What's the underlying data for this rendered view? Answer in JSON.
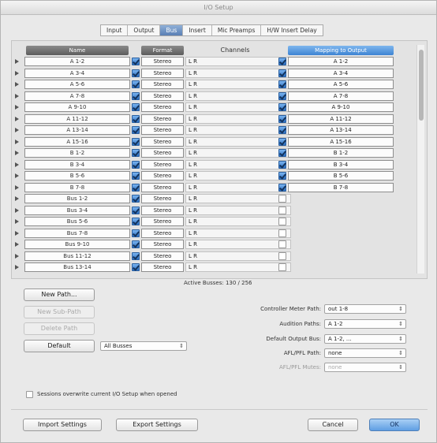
{
  "window": {
    "title": "I/O Setup"
  },
  "tabs": [
    "Input",
    "Output",
    "Bus",
    "Insert",
    "Mic Preamps",
    "H/W Insert Delay"
  ],
  "active_tab": "Bus",
  "columns": {
    "name": "Name",
    "format": "Format",
    "channels": "Channels",
    "mapping": "Mapping to Output"
  },
  "rows": [
    {
      "name": "A 1-2",
      "format": "Stereo",
      "channels": "L  R",
      "mapped": true,
      "output": "A 1-2"
    },
    {
      "name": "A 3-4",
      "format": "Stereo",
      "channels": "L  R",
      "mapped": true,
      "output": "A 3-4"
    },
    {
      "name": "A 5-6",
      "format": "Stereo",
      "channels": "L  R",
      "mapped": true,
      "output": "A 5-6"
    },
    {
      "name": "A 7-8",
      "format": "Stereo",
      "channels": "L  R",
      "mapped": true,
      "output": "A 7-8"
    },
    {
      "name": "A 9-10",
      "format": "Stereo",
      "channels": "L  R",
      "mapped": true,
      "output": "A 9-10"
    },
    {
      "name": "A 11-12",
      "format": "Stereo",
      "channels": "L  R",
      "mapped": true,
      "output": "A 11-12"
    },
    {
      "name": "A 13-14",
      "format": "Stereo",
      "channels": "L  R",
      "mapped": true,
      "output": "A 13-14"
    },
    {
      "name": "A 15-16",
      "format": "Stereo",
      "channels": "L  R",
      "mapped": true,
      "output": "A 15-16"
    },
    {
      "name": "B 1-2",
      "format": "Stereo",
      "channels": "L  R",
      "mapped": true,
      "output": "B 1-2"
    },
    {
      "name": "B 3-4",
      "format": "Stereo",
      "channels": "L  R",
      "mapped": true,
      "output": "B 3-4"
    },
    {
      "name": "B 5-6",
      "format": "Stereo",
      "channels": "L  R",
      "mapped": true,
      "output": "B 5-6"
    },
    {
      "name": "B 7-8",
      "format": "Stereo",
      "channels": "L  R",
      "mapped": true,
      "output": "B 7-8"
    },
    {
      "name": "Bus 1-2",
      "format": "Stereo",
      "channels": "L  R",
      "mapped": false,
      "output": ""
    },
    {
      "name": "Bus 3-4",
      "format": "Stereo",
      "channels": "L  R",
      "mapped": false,
      "output": ""
    },
    {
      "name": "Bus 5-6",
      "format": "Stereo",
      "channels": "L  R",
      "mapped": false,
      "output": ""
    },
    {
      "name": "Bus 7-8",
      "format": "Stereo",
      "channels": "L  R",
      "mapped": false,
      "output": ""
    },
    {
      "name": "Bus 9-10",
      "format": "Stereo",
      "channels": "L  R",
      "mapped": false,
      "output": ""
    },
    {
      "name": "Bus 11-12",
      "format": "Stereo",
      "channels": "L  R",
      "mapped": false,
      "output": ""
    },
    {
      "name": "Bus 13-14",
      "format": "Stereo",
      "channels": "L  R",
      "mapped": false,
      "output": ""
    }
  ],
  "active_busses": "Active Busses:  130 / 256",
  "buttons": {
    "new_path": "New Path...",
    "new_sub_path": "New Sub-Path",
    "delete_path": "Delete Path",
    "default": "Default",
    "import": "Import Settings",
    "export": "Export Settings",
    "cancel": "Cancel",
    "ok": "OK"
  },
  "default_select": "All Busses",
  "settings": {
    "controller_meter_path_label": "Controller Meter Path:",
    "controller_meter_path_value": "out 1-8",
    "audition_paths_label": "Audition Paths:",
    "audition_paths_value": "A 1-2",
    "default_output_bus_label": "Default Output Bus:",
    "default_output_bus_value": "A 1-2, ...",
    "afl_pfl_path_label": "AFL/PFL Path:",
    "afl_pfl_path_value": "none",
    "afl_pfl_mutes_label": "AFL/PFL Mutes:",
    "afl_pfl_mutes_value": "none"
  },
  "sessions_overwrite": "Sessions overwrite current I/O Setup when opened",
  "colors": {
    "accent": "#3d84d2",
    "header_gray": "#5d5d5d"
  }
}
